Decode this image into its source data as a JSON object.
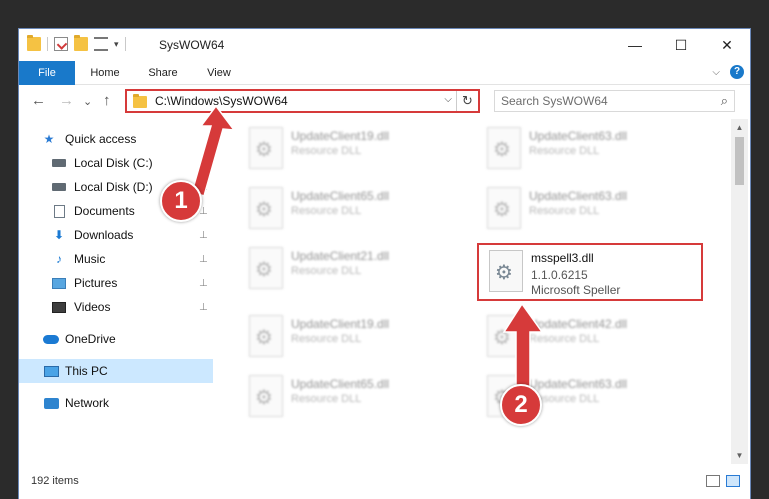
{
  "window": {
    "title": "SysWOW64",
    "controls": {
      "minimize": "—",
      "maximize": "☐",
      "close": "✕"
    }
  },
  "ribbon": {
    "tabs": [
      "File",
      "Home",
      "Share",
      "View"
    ],
    "expand_chevron": "⌵",
    "help": "?"
  },
  "navigation": {
    "back": "←",
    "forward": "→",
    "recent": "⌄",
    "up": "↑"
  },
  "address": {
    "path": "C:\\Windows\\SysWOW64",
    "dropdown": "⌵",
    "refresh": "↻"
  },
  "search": {
    "placeholder": "Search SysWOW64",
    "icon": "⌕"
  },
  "sidebar": {
    "items": [
      {
        "label": "Quick access",
        "icon": "star-icon"
      },
      {
        "label": "Local Disk (C:)",
        "icon": "disk-icon",
        "pinned": true
      },
      {
        "label": "Local Disk (D:)",
        "icon": "disk-icon",
        "pinned": true
      },
      {
        "label": "Documents",
        "icon": "documents-icon",
        "pinned": true
      },
      {
        "label": "Downloads",
        "icon": "downloads-icon",
        "pinned": true
      },
      {
        "label": "Music",
        "icon": "music-icon",
        "pinned": true
      },
      {
        "label": "Pictures",
        "icon": "pictures-icon",
        "pinned": true
      },
      {
        "label": "Videos",
        "icon": "videos-icon",
        "pinned": true
      },
      {
        "label": "OneDrive",
        "icon": "cloud-icon"
      },
      {
        "label": "This PC",
        "icon": "pc-icon",
        "selected": true
      },
      {
        "label": "Network",
        "icon": "network-icon"
      }
    ],
    "pin_glyph": "📌"
  },
  "files": [
    {
      "name": "UpdateClient19.dll",
      "type": "Resource DLL"
    },
    {
      "name": "UpdateClient63.dll",
      "type": "Resource DLL"
    },
    {
      "name": "UpdateClient65.dll",
      "type": "Resource DLL"
    },
    {
      "name": "UpdateClient63.dll",
      "type": "Resource DLL"
    },
    {
      "name": "UpdateClient21.dll",
      "type": "Resource DLL"
    },
    {
      "name": "msspell3.dll",
      "version": "1.1.0.6215",
      "description": "Microsoft Speller",
      "selected": true
    },
    {
      "name": "UpdateClient19.dll",
      "type": "Resource DLL"
    },
    {
      "name": "UpdateClient42.dll",
      "type": "Resource DLL"
    },
    {
      "name": "UpdateClient65.dll",
      "type": "Resource DLL"
    },
    {
      "name": "UpdateClient63.dll",
      "type": "Resource DLL"
    }
  ],
  "status": {
    "item_count": "192 items"
  },
  "annotations": {
    "step1": "1",
    "step2": "2"
  },
  "colors": {
    "accent": "#1979ca",
    "highlight": "#d63a3a",
    "selected_nav": "#cce8ff"
  }
}
